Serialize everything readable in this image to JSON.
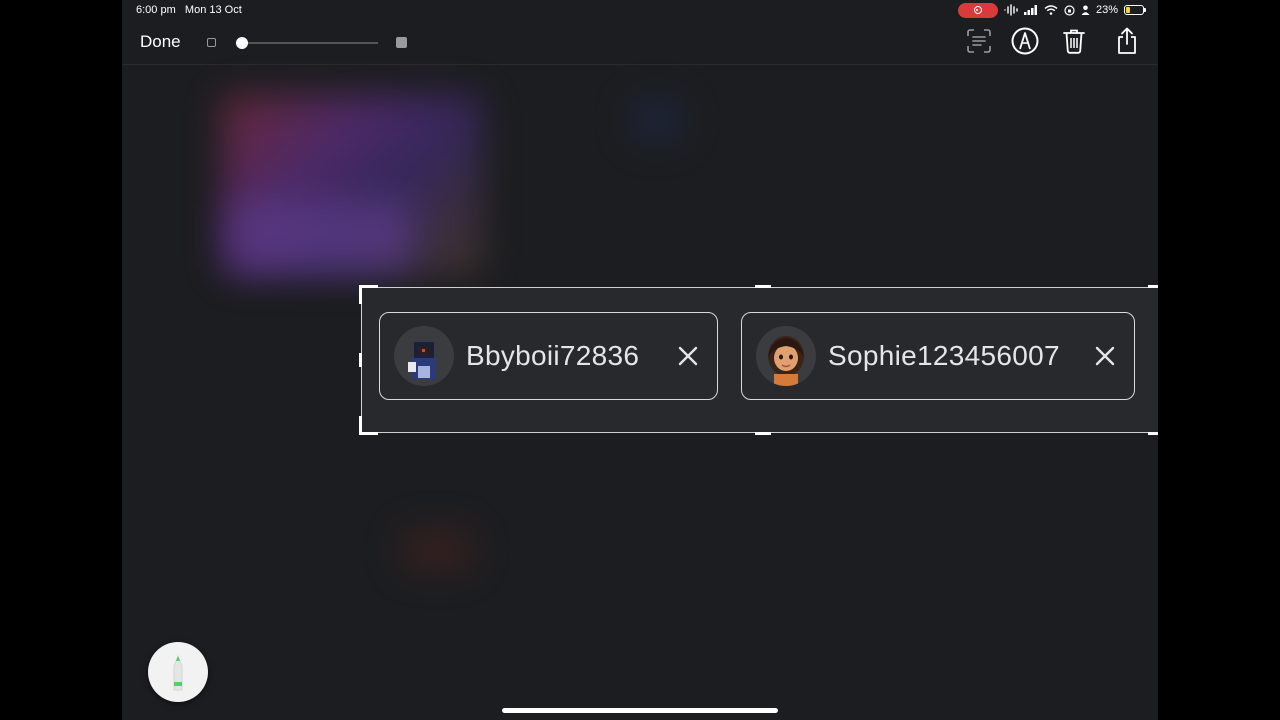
{
  "status_bar": {
    "time": "6:00 pm",
    "date": "Mon 13 Oct",
    "battery": "23%",
    "battery_level": 0.23,
    "icons": [
      "screen-record-icon",
      "mic-waveform-icon",
      "signal-icon",
      "wifi-icon",
      "orientation-lock-icon",
      "person-icon",
      "battery-icon"
    ]
  },
  "toolbar": {
    "done_label": "Done",
    "brush_size_fraction": 0.0,
    "icons": [
      "text-recognition-icon",
      "markup-pen-icon",
      "trash-icon",
      "share-icon"
    ]
  },
  "selection": {
    "chips": [
      {
        "name": "Bbyboii72836",
        "avatar": "avatar-icon"
      },
      {
        "name": "Sophie123456007",
        "avatar": "avatar-icon"
      }
    ]
  },
  "colors": {
    "background": "#1c1d20",
    "record_red": "#d93a3a",
    "battery_yellow": "#f5d33a",
    "pencil_tip_green": "#4cd36a"
  }
}
